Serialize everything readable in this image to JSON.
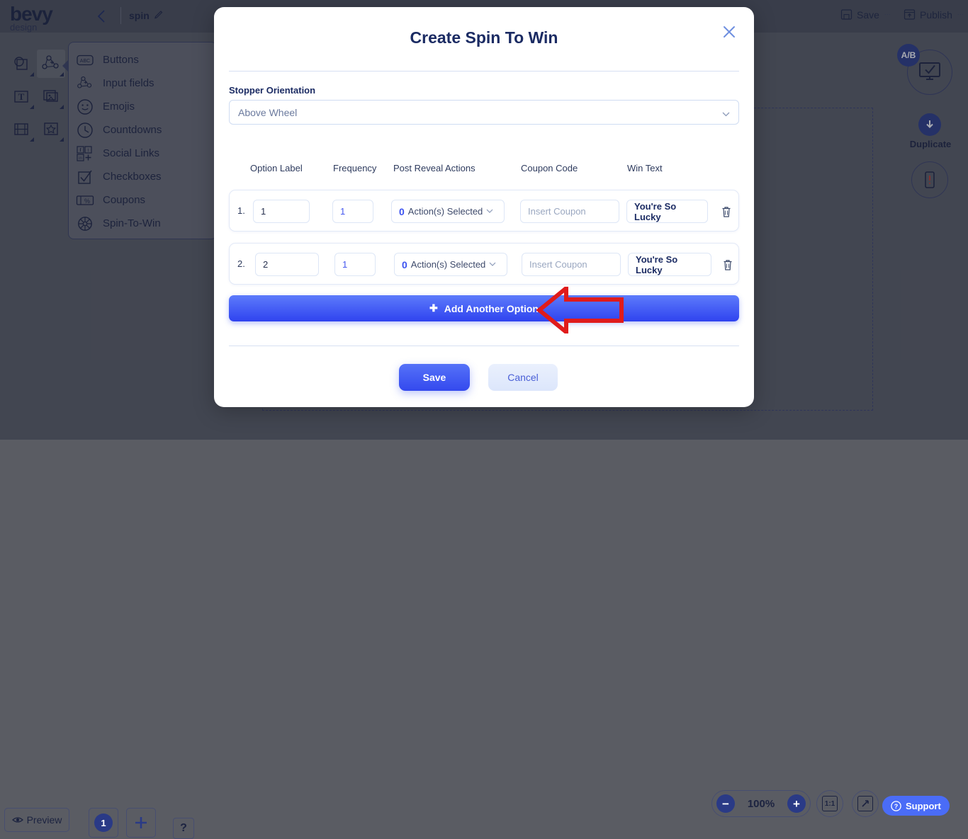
{
  "app": {
    "logo_main": "bevy",
    "logo_sub": "design",
    "doc_title": "spin",
    "topbar": {
      "save_label": "Save",
      "publish_label": "Publish",
      "caret": "⋯"
    },
    "flyout": {
      "items": [
        {
          "label": "Buttons",
          "icon": "abc-button-icon"
        },
        {
          "label": "Input fields",
          "icon": "input-field-icon"
        },
        {
          "label": "Emojis",
          "icon": "emoji-smiley-icon"
        },
        {
          "label": "Countdowns",
          "icon": "clock-icon"
        },
        {
          "label": "Social Links",
          "icon": "social-links-icon"
        },
        {
          "label": "Checkboxes",
          "icon": "checkbox-icon"
        },
        {
          "label": "Coupons",
          "icon": "coupon-percent-icon"
        },
        {
          "label": "Spin-To-Win",
          "icon": "spin-wheel-icon"
        }
      ]
    },
    "right_controls": {
      "ab_badge": "A/B",
      "duplicate_label": "Duplicate"
    },
    "bottom": {
      "preview_label": "Preview",
      "page_number": "1",
      "add_page": "+",
      "help": "?",
      "zoom_minus": "−",
      "zoom_value": "100%",
      "zoom_plus": "+",
      "ratio_label": "1:1",
      "support_label": "Support"
    }
  },
  "modal": {
    "title": "Create Spin To Win",
    "close_icon": "close-icon",
    "stopper": {
      "label": "Stopper Orientation",
      "value": "Above Wheel",
      "options": [
        "Above Wheel"
      ]
    },
    "table": {
      "headers": [
        "Option Label",
        "Frequency",
        "Post Reveal Actions",
        "Coupon Code",
        "Win Text"
      ],
      "rows": [
        {
          "index": "1.",
          "option_label": "1",
          "frequency": "1",
          "actions_count": "0",
          "actions_caption": "Action(s) Selected",
          "coupon_placeholder": "Insert Coupon",
          "coupon_value": "",
          "win_text": "You're So Lucky",
          "delete_icon": "trash-icon"
        },
        {
          "index": "2.",
          "option_label": "2",
          "frequency": "1",
          "actions_count": "0",
          "actions_caption": "Action(s) Selected",
          "coupon_placeholder": "Insert Coupon",
          "coupon_value": "",
          "win_text": "You're So Lucky",
          "delete_icon": "trash-icon"
        }
      ]
    },
    "add_option_label": "Add Another Option",
    "add_option_plus": "✚",
    "save_label": "Save",
    "cancel_label": "Cancel"
  },
  "annotation": {
    "shape": "left-pointing-arrow",
    "color": "#e01b1b",
    "points_at": "Add Another Option"
  },
  "colors": {
    "primary_blue": "#3449ee",
    "modal_title": "#1b2b63",
    "annotation_red": "#e01b1b",
    "app_bg": "#5a5c63"
  }
}
